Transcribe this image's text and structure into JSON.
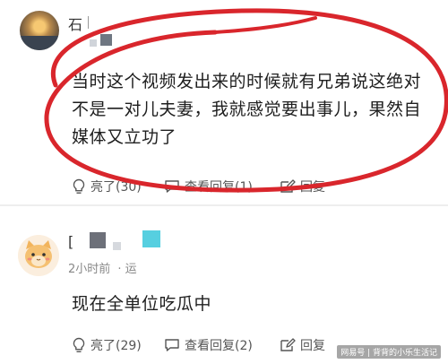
{
  "comment1": {
    "username": "石",
    "text": "当时这个视频发出来的时候就有兄弟说这绝对不是一对儿夫妻，我就感觉要出事儿，果然自媒体又立功了",
    "like_label": "亮了(30)",
    "replies_label": "查看回复(1)",
    "reply_label": "回复"
  },
  "comment2": {
    "username": "[",
    "time": "2小时前",
    "time_suffix": "·  运",
    "text": "现在全单位吃瓜中",
    "like_label": "亮了(29)",
    "replies_label": "查看回复(2)",
    "reply_label": "回复"
  },
  "watermark": "网易号 | 背背的小乐生活记",
  "colors": {
    "annotation": "#d9262c",
    "icon": "#555555",
    "divider": "#eeeeee"
  },
  "icons": [
    "lightbulb-icon",
    "comment-bubble-icon",
    "pen-edit-icon"
  ]
}
